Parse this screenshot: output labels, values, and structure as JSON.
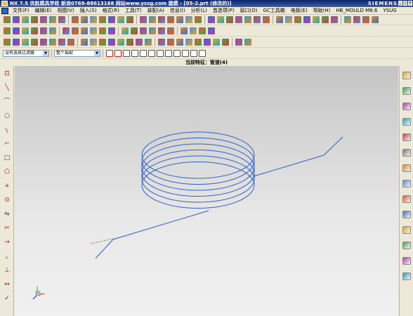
{
  "window": {
    "title": "NX 7.5 优胜模具学校 新浪0769-88613168 网站www.yssg.com 建模 - [05-2.prt (修改的)]",
    "brand": "SIEMENS"
  },
  "menu": [
    "文件(F)",
    "编辑(E)",
    "视图(V)",
    "插入(S)",
    "格式(R)",
    "工具(T)",
    "装配(A)",
    "信息(I)",
    "分析(L)",
    "首选项(P)",
    "窗口(O)",
    "GC工具箱",
    "电极(E)",
    "帮助(H)",
    "HB_MOULD M6.6",
    "YSUG"
  ],
  "selection_bar": {
    "filter_value": "没有选择过滤器",
    "scope_value": "整个装配"
  },
  "status_line": "当前特征：管道(4)",
  "colors": {
    "curve": "#2e5fc9",
    "menu_bg": "#ece9d8",
    "title_bg": "#0a246a"
  },
  "icons": {
    "toolbar_row1": [
      "new-icon",
      "open-icon",
      "save-icon",
      "cut-icon",
      "copy-icon",
      "paste-icon",
      "undo-icon",
      "redo-icon",
      "extrude-icon",
      "revolve-icon",
      "hole-icon",
      "boss-icon",
      "pocket-icon",
      "edge-blend-icon",
      "chamfer-icon",
      "shell-icon",
      "draft-icon",
      "trim-body-icon",
      "split-body-icon",
      "unite-icon",
      "subtract-icon",
      "intersect-icon",
      "sweep-icon",
      "tube-icon",
      "datum-plane-icon",
      "datum-axis-icon",
      "sketch-icon",
      "mirror-icon",
      "pattern-icon",
      "offset-face-icon",
      "replace-face-icon",
      "move-face-icon",
      "delete-face-icon",
      "shade-icon",
      "wireframe-icon",
      "zoom-icon",
      "pan-icon",
      "rotate-icon",
      "fit-icon"
    ],
    "toolbar_row2": [
      "layer-icon",
      "layer-settings-icon",
      "move-to-layer-icon",
      "copy-to-layer-icon",
      "show-hide-icon",
      "hide-icon",
      "show-all-icon",
      "invert-show-icon",
      "view-front-icon",
      "view-top-icon",
      "view-right-icon",
      "view-iso-icon",
      "view-trimetric-icon",
      "edit-object-display-icon",
      "color-icon",
      "transparency-icon",
      "point-icon",
      "wcs-icon",
      "csys-icon",
      "measure-distance-icon",
      "measure-angle-icon",
      "info-icon"
    ],
    "toolbar_row3": [
      "line-icon",
      "arc-icon",
      "circle-icon",
      "rectangle-icon",
      "text-icon",
      "spline-icon",
      "helix-icon",
      "project-curve-icon",
      "intersection-curve-icon",
      "offset-curve-icon",
      "bridge-curve-icon",
      "join-curve-icon",
      "trim-curve-icon",
      "divide-curve-icon",
      "extract-curve-icon",
      "composite-curve-icon",
      "isoparametric-icon",
      "section-curve-icon",
      "fillet-curve-icon",
      "chamfer-curve-icon",
      "curve-length-icon",
      "sphere-icon",
      "block-icon",
      "cylinder-icon",
      "cone-icon",
      "mesh-icon"
    ],
    "snap_bar": [
      "select-all-icon",
      "undo-select-icon",
      "point-on-curve-icon",
      "end-point-icon",
      "mid-point-icon",
      "control-point-icon",
      "intersection-point-icon",
      "center-point-icon",
      "quadrant-point-icon",
      "existing-point-icon",
      "point-on-face-icon",
      "arc-center-icon"
    ],
    "left_toolbar": [
      "sketch-profile-icon",
      "line-icon",
      "arc-icon",
      "circle-icon",
      "fillet-icon",
      "chamfer-icon",
      "rectangle-icon",
      "polygon-icon",
      "point-icon",
      "offset-icon",
      "mirror-icon",
      "trim-icon",
      "extend-icon",
      "corner-icon",
      "constraint-icon",
      "dimension-icon",
      "finish-sketch-icon"
    ],
    "right_toolbar": [
      "assembly-navigator-icon",
      "part-navigator-icon",
      "reuse-library-icon",
      "hd3d-icon",
      "web-browser-icon",
      "history-icon",
      "process-studio-icon",
      "manufacturing-icon",
      "roles-icon",
      "system-scenes-icon",
      "system-materials-icon",
      "palette-icon",
      "knowledge-icon",
      "journal-icon"
    ]
  }
}
